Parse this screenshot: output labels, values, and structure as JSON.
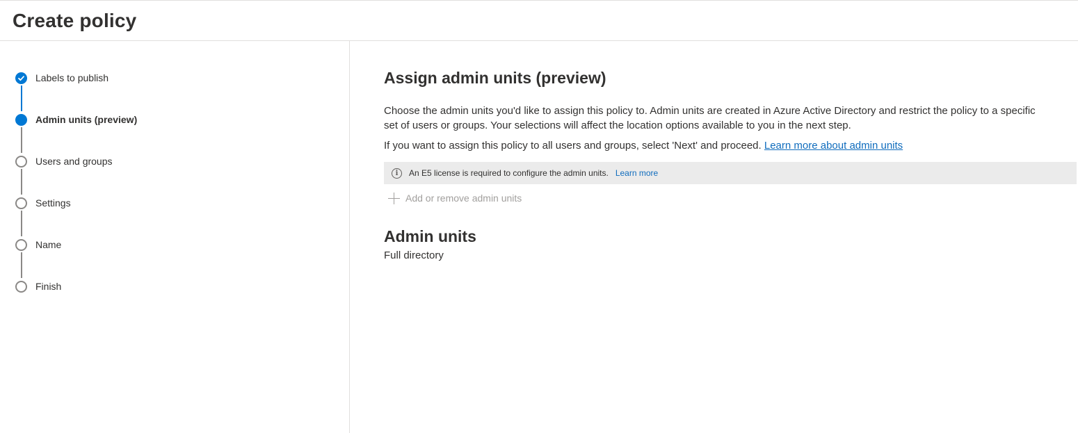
{
  "header": {
    "title": "Create policy"
  },
  "wizard": {
    "steps": [
      {
        "label": "Labels to publish",
        "state": "done"
      },
      {
        "label": "Admin units (preview)",
        "state": "current"
      },
      {
        "label": "Users and groups",
        "state": "pending"
      },
      {
        "label": "Settings",
        "state": "pending"
      },
      {
        "label": "Name",
        "state": "pending"
      },
      {
        "label": "Finish",
        "state": "pending"
      }
    ]
  },
  "main": {
    "title": "Assign admin units (preview)",
    "description": "Choose the admin units you'd like to assign this policy to. Admin units are created in Azure Active Directory and restrict the policy to a specific set of users or groups. Your selections will affect the location options available to you in the next step.",
    "all_users_text": "If you want to assign this policy to all users and groups, select 'Next' and proceed.",
    "learn_more_link": "Learn more about admin units",
    "info_bar": {
      "icon": "info-icon",
      "message": "An E5 license is required to configure the admin units.",
      "link": "Learn more"
    },
    "add_button": {
      "icon": "plus-icon",
      "label": "Add or remove admin units"
    },
    "admin_units_section": {
      "title": "Admin units",
      "value": "Full directory"
    }
  },
  "colors": {
    "accent": "#0078d4",
    "link": "#0f6cbd",
    "text": "#323130",
    "disabled": "#a19f9d",
    "info_bar_bg": "#ebebeb"
  }
}
